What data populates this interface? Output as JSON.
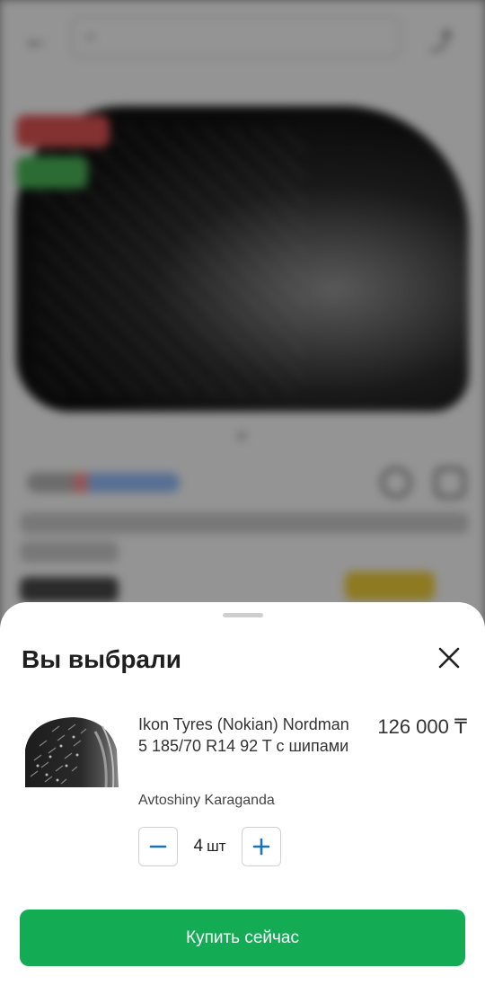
{
  "sheet": {
    "title": "Вы выбрали",
    "buy_button_label": "Купить сейчас"
  },
  "product": {
    "name": "Ikon Tyres (Nokian) Nordman 5 185/70 R14 92 T с шипами",
    "price": "126 000 ₸",
    "seller": "Avtoshiny Karaganda",
    "quantity": "4",
    "quantity_unit": "шт"
  },
  "colors": {
    "accent": "#14ab55",
    "qty_icon": "#1a73b8"
  },
  "icons": {
    "close": "close-icon",
    "minus": "minus-icon",
    "plus": "plus-icon"
  }
}
